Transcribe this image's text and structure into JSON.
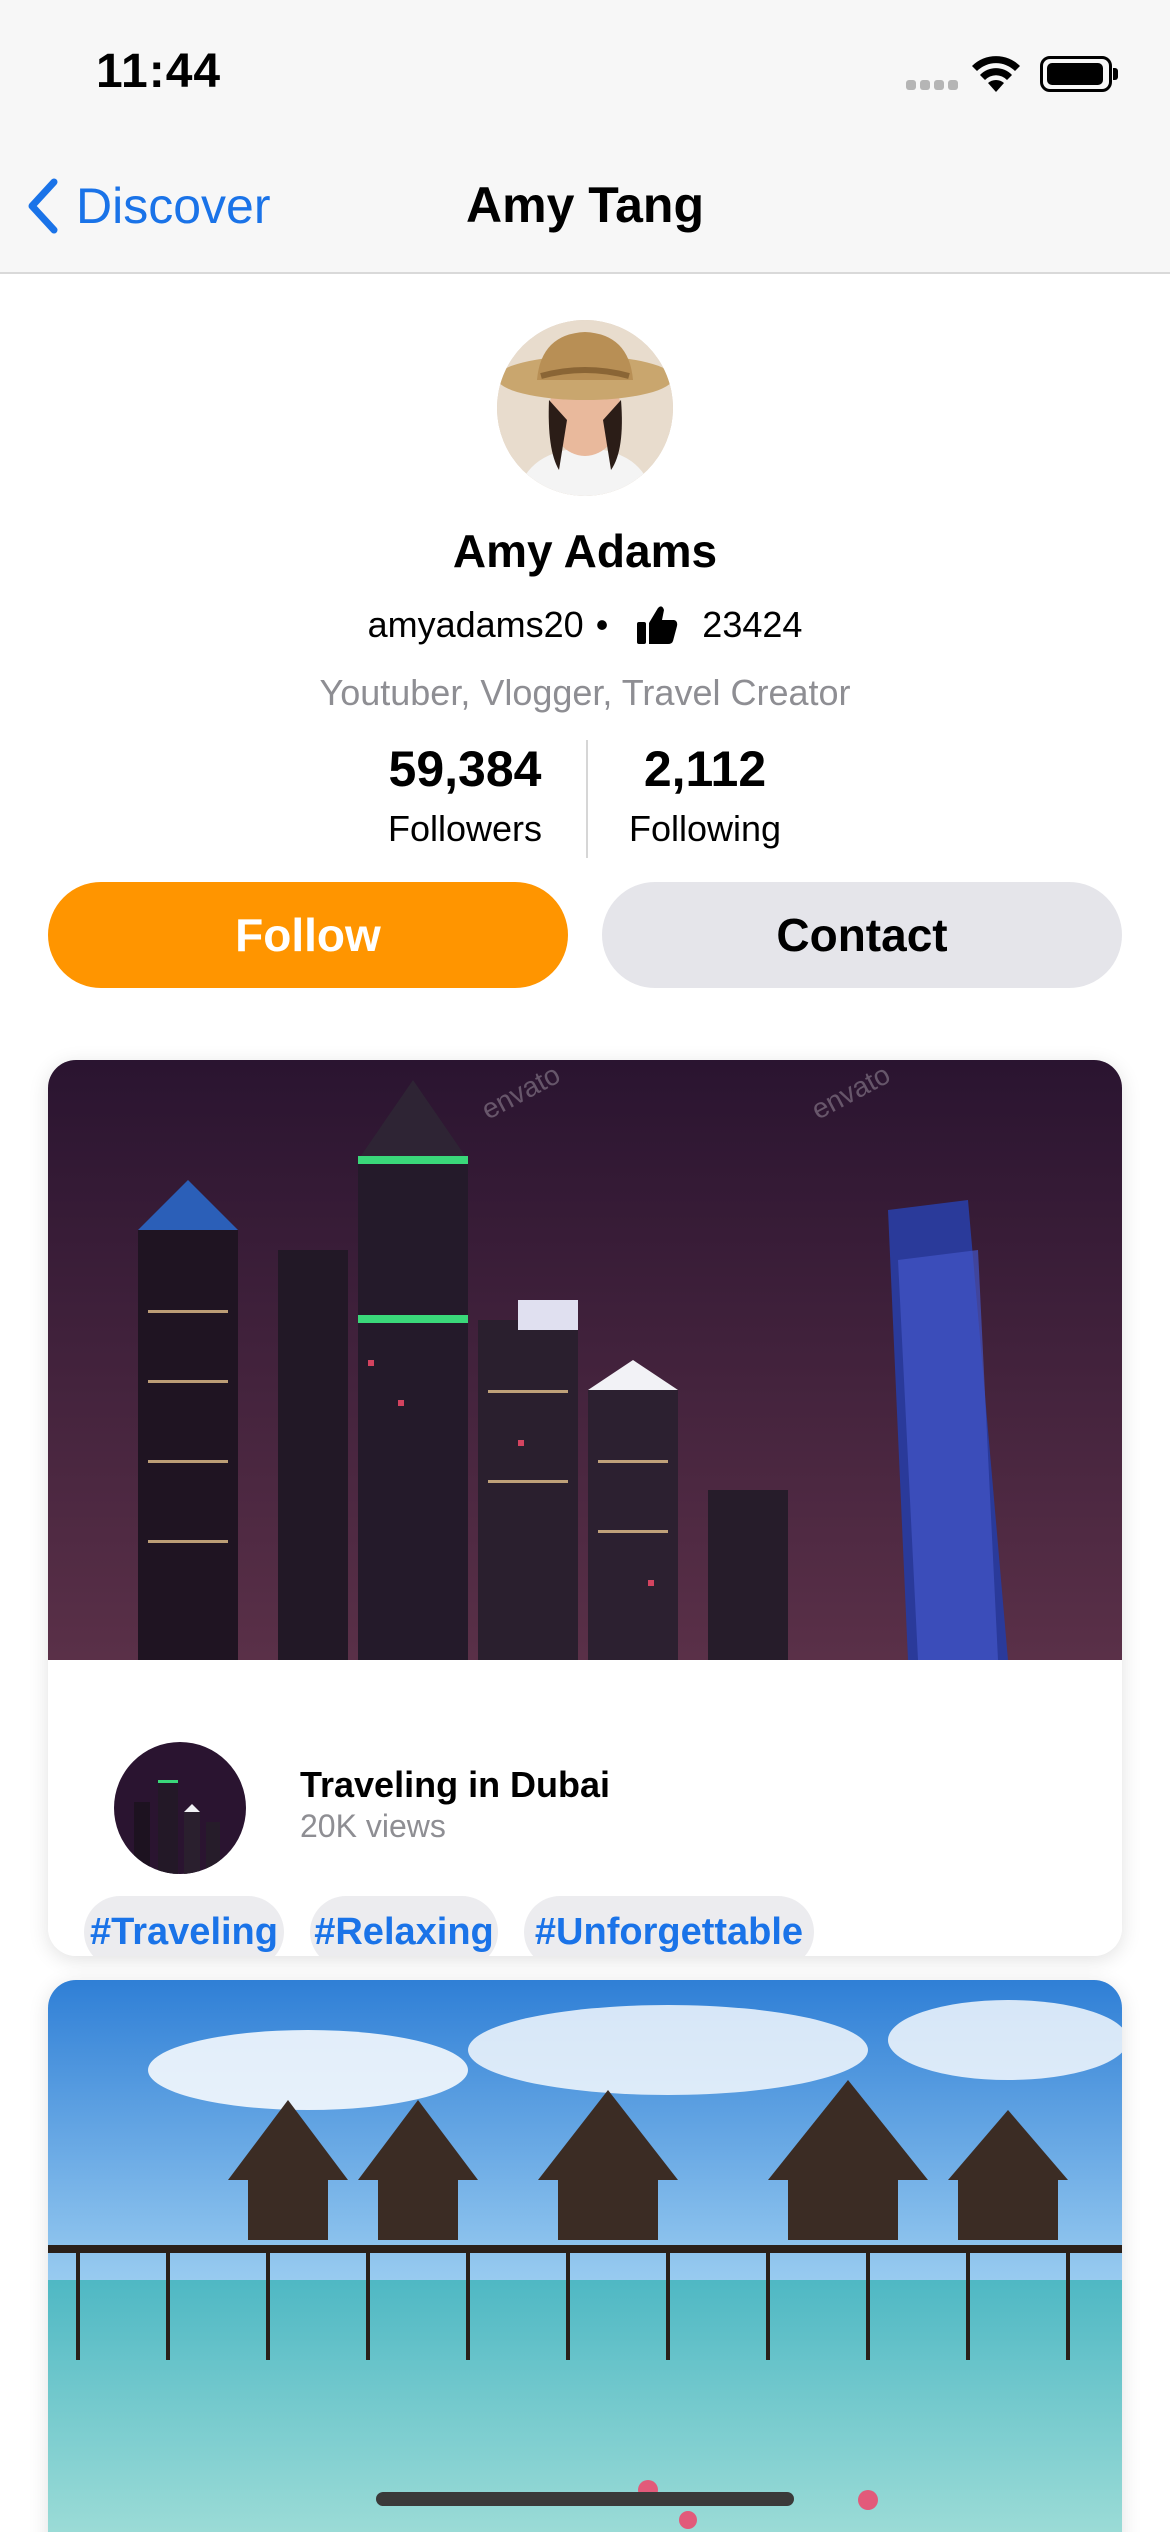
{
  "status_bar": {
    "time": "11:44"
  },
  "nav": {
    "back_label": "Discover",
    "title": "Amy Tang"
  },
  "profile": {
    "name": "Amy Adams",
    "username": "amyadams20",
    "separator": "•",
    "likes": "23424",
    "bio": "Youtuber, Vlogger, Travel Creator",
    "followers_value": "59,384",
    "followers_label": "Followers",
    "following_value": "2,112",
    "following_label": "Following"
  },
  "actions": {
    "follow_label": "Follow",
    "contact_label": "Contact"
  },
  "posts": [
    {
      "title": "Traveling in Dubai",
      "views": "20K views",
      "tags": [
        "#Traveling",
        "#Relaxing",
        "#Unforgettable"
      ]
    }
  ],
  "colors": {
    "accent": "#ff9500",
    "link": "#1a73e8",
    "secondary_text": "#8e8e93",
    "button_gray": "#e5e5ea"
  },
  "icons": {
    "back": "chevron-left-icon",
    "likes": "thumbs-up-icon",
    "wifi": "wifi-icon",
    "battery": "battery-icon"
  }
}
